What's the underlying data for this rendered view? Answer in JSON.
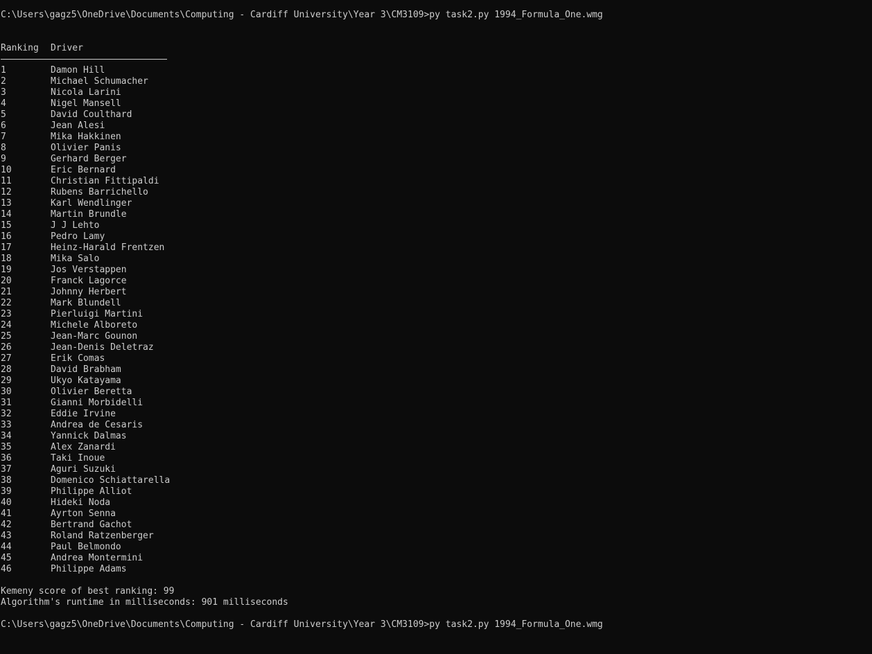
{
  "terminal": {
    "background": "#0c0c0c",
    "foreground": "#cccccc",
    "command_line_1": "C:\\Users\\gagz5\\OneDrive\\Documents\\Computing - Cardiff University\\Year 3\\CM3109>py task2.py 1994_Formula_One.wmg",
    "table_headers": {
      "ranking": "Ranking",
      "driver": "Driver"
    },
    "rows": [
      {
        "rank": "1",
        "driver": "Damon Hill"
      },
      {
        "rank": "2",
        "driver": "Michael Schumacher"
      },
      {
        "rank": "3",
        "driver": "Nicola Larini"
      },
      {
        "rank": "4",
        "driver": "Nigel Mansell"
      },
      {
        "rank": "5",
        "driver": "David Coulthard"
      },
      {
        "rank": "6",
        "driver": "Jean Alesi"
      },
      {
        "rank": "7",
        "driver": "Mika Hakkinen"
      },
      {
        "rank": "8",
        "driver": "Olivier Panis"
      },
      {
        "rank": "9",
        "driver": "Gerhard Berger"
      },
      {
        "rank": "10",
        "driver": "Eric Bernard"
      },
      {
        "rank": "11",
        "driver": "Christian Fittipaldi"
      },
      {
        "rank": "12",
        "driver": "Rubens Barrichello"
      },
      {
        "rank": "13",
        "driver": "Karl Wendlinger"
      },
      {
        "rank": "14",
        "driver": "Martin Brundle"
      },
      {
        "rank": "15",
        "driver": "J J Lehto"
      },
      {
        "rank": "16",
        "driver": "Pedro Lamy"
      },
      {
        "rank": "17",
        "driver": "Heinz-Harald Frentzen"
      },
      {
        "rank": "18",
        "driver": "Mika Salo"
      },
      {
        "rank": "19",
        "driver": "Jos Verstappen"
      },
      {
        "rank": "20",
        "driver": "Franck Lagorce"
      },
      {
        "rank": "21",
        "driver": "Johnny Herbert"
      },
      {
        "rank": "22",
        "driver": "Mark Blundell"
      },
      {
        "rank": "23",
        "driver": "Pierluigi Martini"
      },
      {
        "rank": "24",
        "driver": "Michele Alboreto"
      },
      {
        "rank": "25",
        "driver": "Jean-Marc Gounon"
      },
      {
        "rank": "26",
        "driver": "Jean-Denis Deletraz"
      },
      {
        "rank": "27",
        "driver": "Erik Comas"
      },
      {
        "rank": "28",
        "driver": "David Brabham"
      },
      {
        "rank": "29",
        "driver": "Ukyo Katayama"
      },
      {
        "rank": "30",
        "driver": "Olivier Beretta"
      },
      {
        "rank": "31",
        "driver": "Gianni Morbidelli"
      },
      {
        "rank": "32",
        "driver": "Eddie Irvine"
      },
      {
        "rank": "33",
        "driver": "Andrea de Cesaris"
      },
      {
        "rank": "34",
        "driver": "Yannick Dalmas"
      },
      {
        "rank": "35",
        "driver": "Alex Zanardi"
      },
      {
        "rank": "36",
        "driver": "Taki Inoue"
      },
      {
        "rank": "37",
        "driver": "Aguri Suzuki"
      },
      {
        "rank": "38",
        "driver": "Domenico Schiattarella"
      },
      {
        "rank": "39",
        "driver": "Philippe Alliot"
      },
      {
        "rank": "40",
        "driver": "Hideki Noda"
      },
      {
        "rank": "41",
        "driver": "Ayrton Senna"
      },
      {
        "rank": "42",
        "driver": "Bertrand Gachot"
      },
      {
        "rank": "43",
        "driver": "Roland Ratzenberger"
      },
      {
        "rank": "44",
        "driver": "Paul Belmondo"
      },
      {
        "rank": "45",
        "driver": "Andrea Montermini"
      },
      {
        "rank": "46",
        "driver": "Philippe Adams"
      }
    ],
    "kemeny_score_line": "Kemeny score of best ranking: 99",
    "runtime_line": "Algorithm's runtime in milliseconds: 901 milliseconds",
    "command_line_2": "C:\\Users\\gagz5\\OneDrive\\Documents\\Computing - Cardiff University\\Year 3\\CM3109>py task2.py 1994_Formula_One.wmg"
  }
}
